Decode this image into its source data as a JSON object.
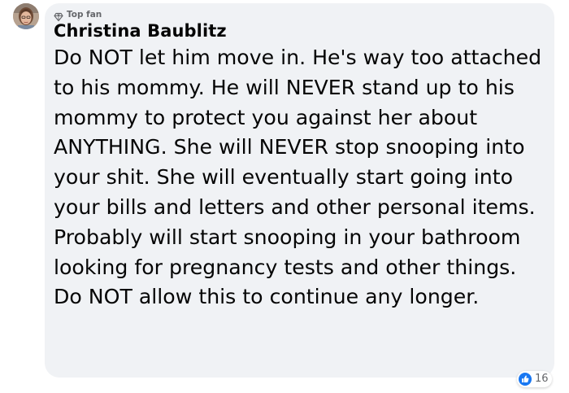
{
  "comment": {
    "badge_label": "Top fan",
    "badge_icon": "diamond-icon",
    "author": "Christina Baublitz",
    "text": "Do NOT let him move in. He's way too attached to his mommy. He will NEVER stand up to his mommy to protect you against her about ANYTHING. She will NEVER stop snooping into your shit. She will eventually start going into your bills and letters and other personal items. Probably will start snooping in your bathroom looking for pregnancy tests and other things. Do NOT allow this to continue any longer.",
    "reaction_icon": "like-icon",
    "reaction_count": "16"
  },
  "colors": {
    "bubble": "#f0f2f5",
    "text": "#050505",
    "secondary_text": "#65676b",
    "like_blue": "#1877f2"
  }
}
